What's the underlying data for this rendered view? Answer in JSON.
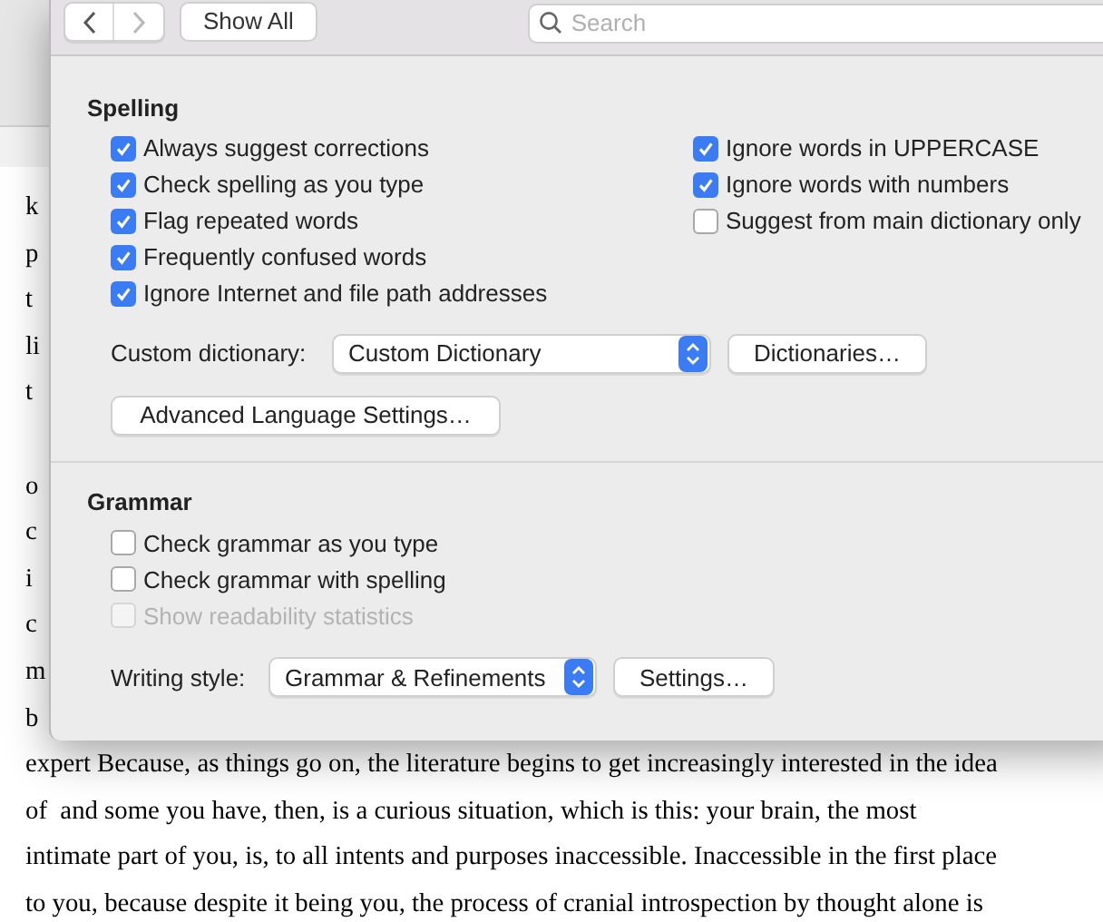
{
  "document": {
    "paragraphs": [
      {
        "lines": [
          "k",
          "p",
          "t",
          "li",
          "t"
        ]
      },
      {
        "lines": [
          "o",
          "c",
          "i",
          "c",
          "m",
          "b",
          "expert Because, as things go on, the literature begins to get increasingly interested in the idea",
          "of  and some you have, then, is a curious situation, which is this: your brain, the most",
          "intimate part of you, is, to all intents and purposes inaccessible. Inaccessible in the first place",
          "to you, because despite it being you, the process of cranial introspection by thought alone is"
        ]
      }
    ]
  },
  "toolbar": {
    "back_button": {
      "disabled": false
    },
    "forward_button": {
      "disabled": true
    },
    "show_all_button": "Show All",
    "search": {
      "placeholder": "Search"
    }
  },
  "spelling": {
    "title": "Spelling",
    "left_options": [
      {
        "label": "Always suggest corrections",
        "checked": true,
        "disabled": false
      },
      {
        "label": "Check spelling as you type",
        "checked": true,
        "disabled": false
      },
      {
        "label": "Flag repeated words",
        "checked": true,
        "disabled": false
      },
      {
        "label": "Frequently confused words",
        "checked": true,
        "disabled": false
      },
      {
        "label": "Ignore Internet and file path addresses",
        "checked": true,
        "disabled": false
      }
    ],
    "right_options": [
      {
        "label": "Ignore words in UPPERCASE",
        "checked": true,
        "disabled": false
      },
      {
        "label": "Ignore words with numbers",
        "checked": true,
        "disabled": false
      },
      {
        "label": "Suggest from main dictionary only",
        "checked": false,
        "disabled": false
      }
    ],
    "custom_dictionary": {
      "label": "Custom dictionary:",
      "value": "Custom Dictionary"
    },
    "dictionaries_button": "Dictionaries…",
    "advanced_button": "Advanced Language Settings…"
  },
  "grammar": {
    "title": "Grammar",
    "options": [
      {
        "label": "Check grammar as you type",
        "checked": false,
        "disabled": false
      },
      {
        "label": "Check grammar with spelling",
        "checked": false,
        "disabled": false
      },
      {
        "label": "Show readability statistics",
        "checked": false,
        "disabled": true
      }
    ],
    "writing_style": {
      "label": "Writing style:",
      "value": "Grammar & Refinements"
    },
    "settings_button": "Settings…"
  }
}
